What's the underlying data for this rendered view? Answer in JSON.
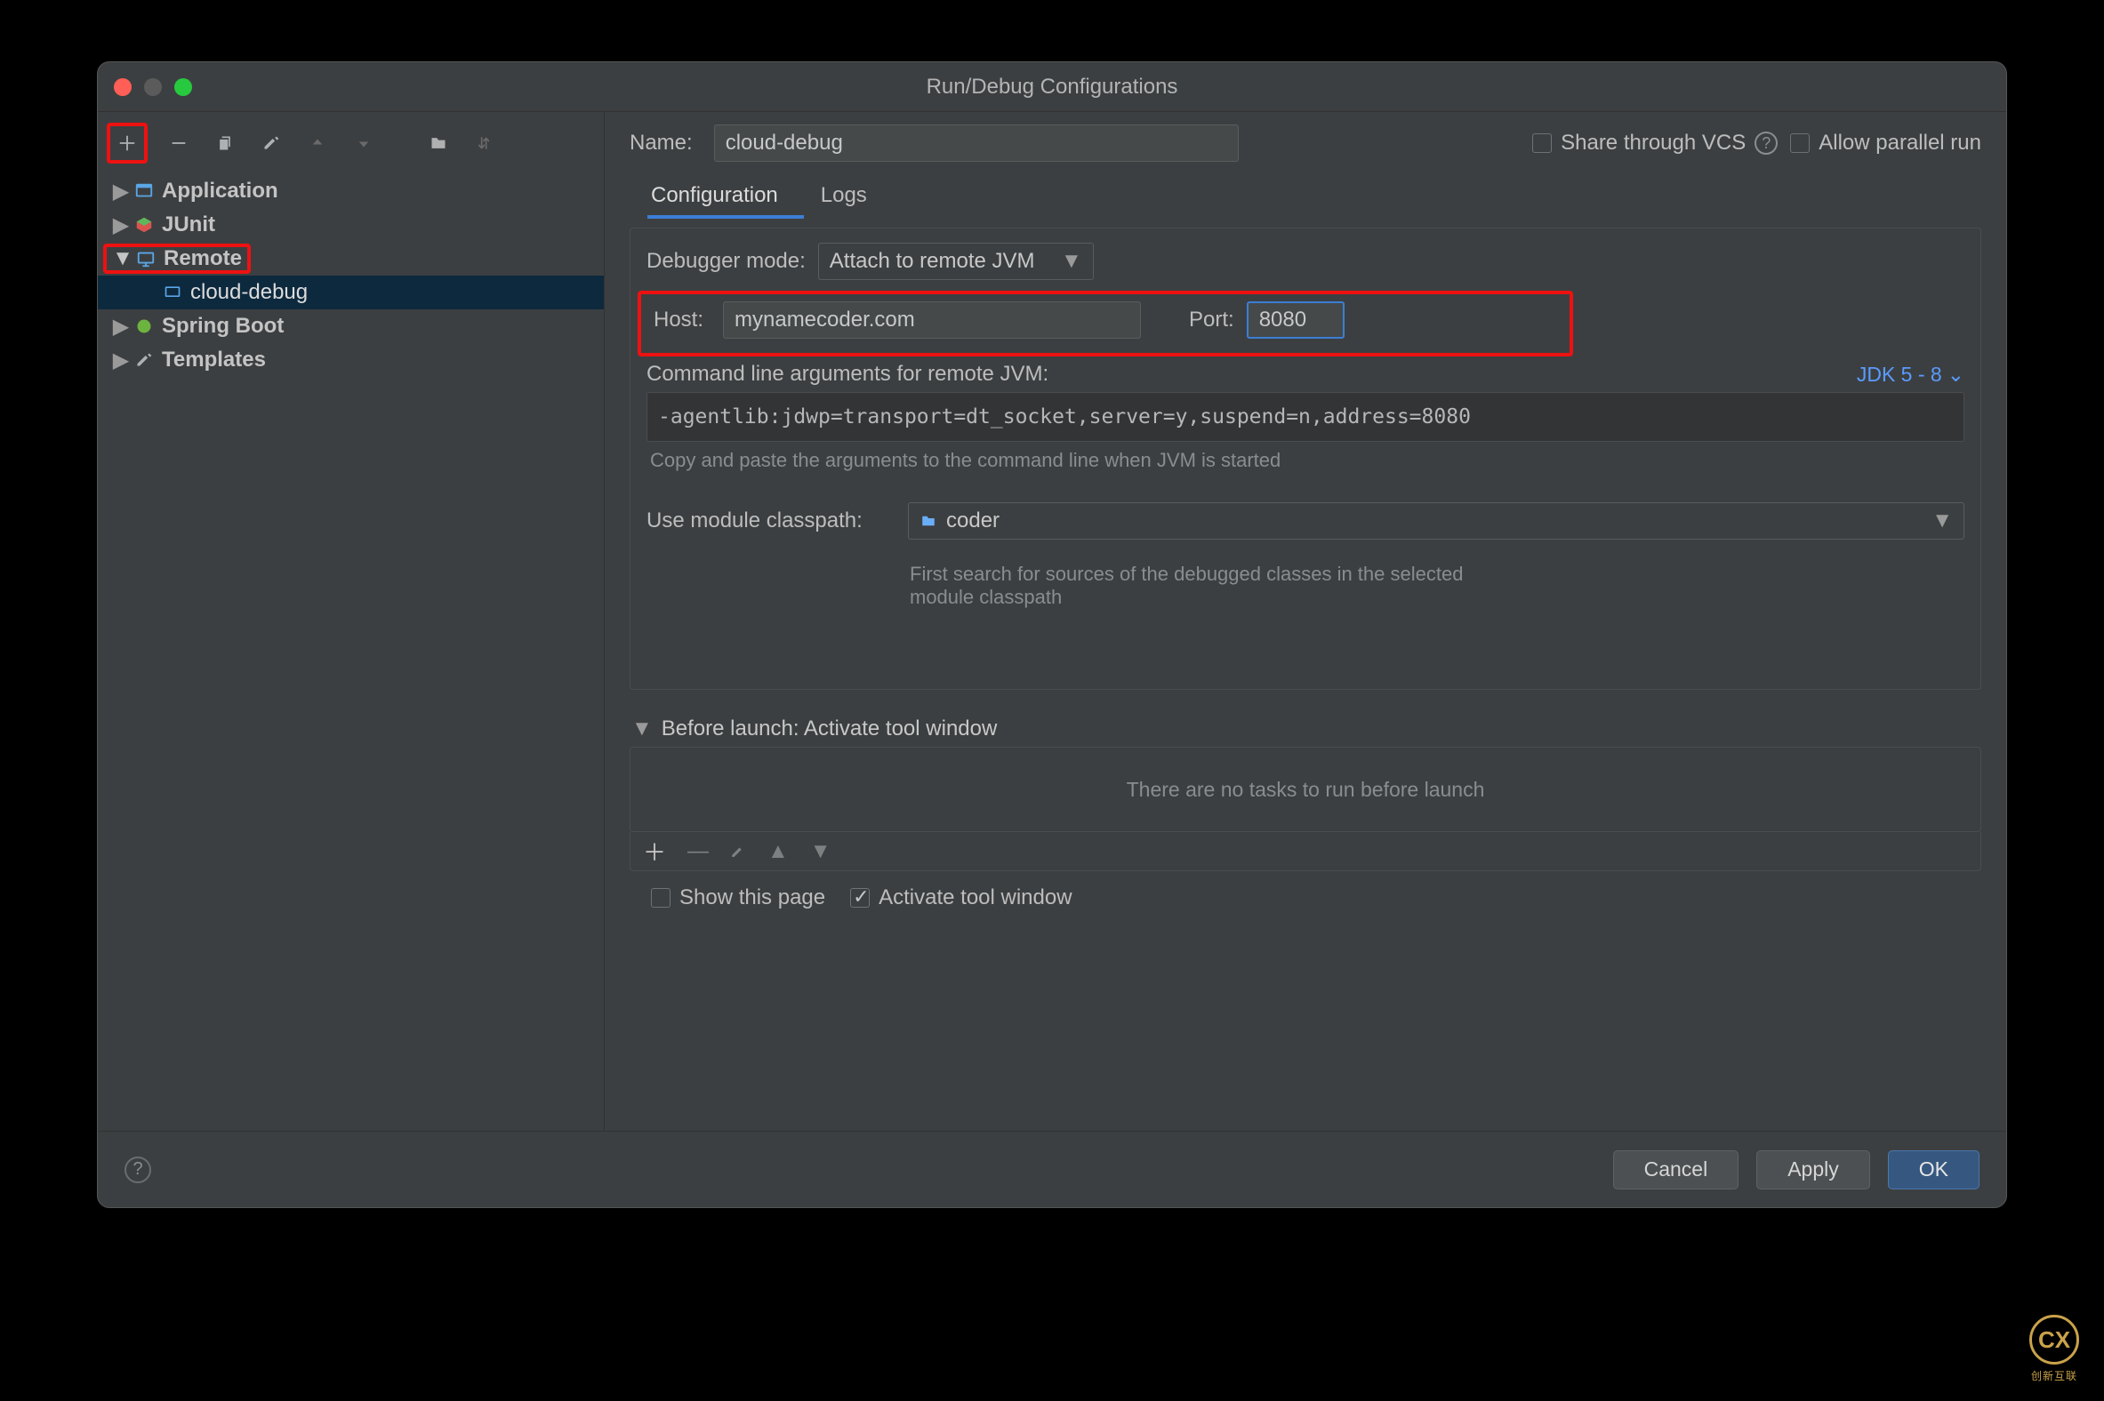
{
  "window": {
    "title": "Run/Debug Configurations"
  },
  "toolbar_icons": {
    "add": "plus",
    "remove": "minus",
    "copy": "copy",
    "wrench": "wrench",
    "up": "up",
    "down": "down",
    "folder": "folder",
    "sort": "sort"
  },
  "tree": {
    "application": {
      "label": "Application"
    },
    "junit": {
      "label": "JUnit"
    },
    "remote": {
      "label": "Remote",
      "children": {
        "cloud_debug": {
          "label": "cloud-debug"
        }
      }
    },
    "spring_boot": {
      "label": "Spring Boot"
    },
    "templates": {
      "label": "Templates"
    }
  },
  "form": {
    "name_label": "Name:",
    "name_value": "cloud-debug",
    "share_label": "Share through VCS",
    "parallel_label": "Allow parallel run",
    "tabs": {
      "configuration": "Configuration",
      "logs": "Logs"
    },
    "debugger_mode_label": "Debugger mode:",
    "debugger_mode_value": "Attach to remote JVM",
    "host_label": "Host:",
    "host_value": "mynamecoder.com",
    "port_label": "Port:",
    "port_value": "8080",
    "cmd_label": "Command line arguments for remote JVM:",
    "jdk_label": "JDK 5 - 8",
    "cmd_value": "-agentlib:jdwp=transport=dt_socket,server=y,suspend=n,address=8080",
    "cmd_hint": "Copy and paste the arguments to the command line when JVM is started",
    "module_label": "Use module classpath:",
    "module_value": "coder",
    "module_hint": "First search for sources of the debugged classes in the selected module classpath"
  },
  "before_launch": {
    "header": "Before launch: Activate tool window",
    "empty": "There are no tasks to run before launch",
    "show_this_page": "Show this page",
    "activate_tool": "Activate tool window"
  },
  "buttons": {
    "cancel": "Cancel",
    "apply": "Apply",
    "ok": "OK"
  },
  "watermark": {
    "glyph": "CX",
    "text": "创新互联"
  }
}
